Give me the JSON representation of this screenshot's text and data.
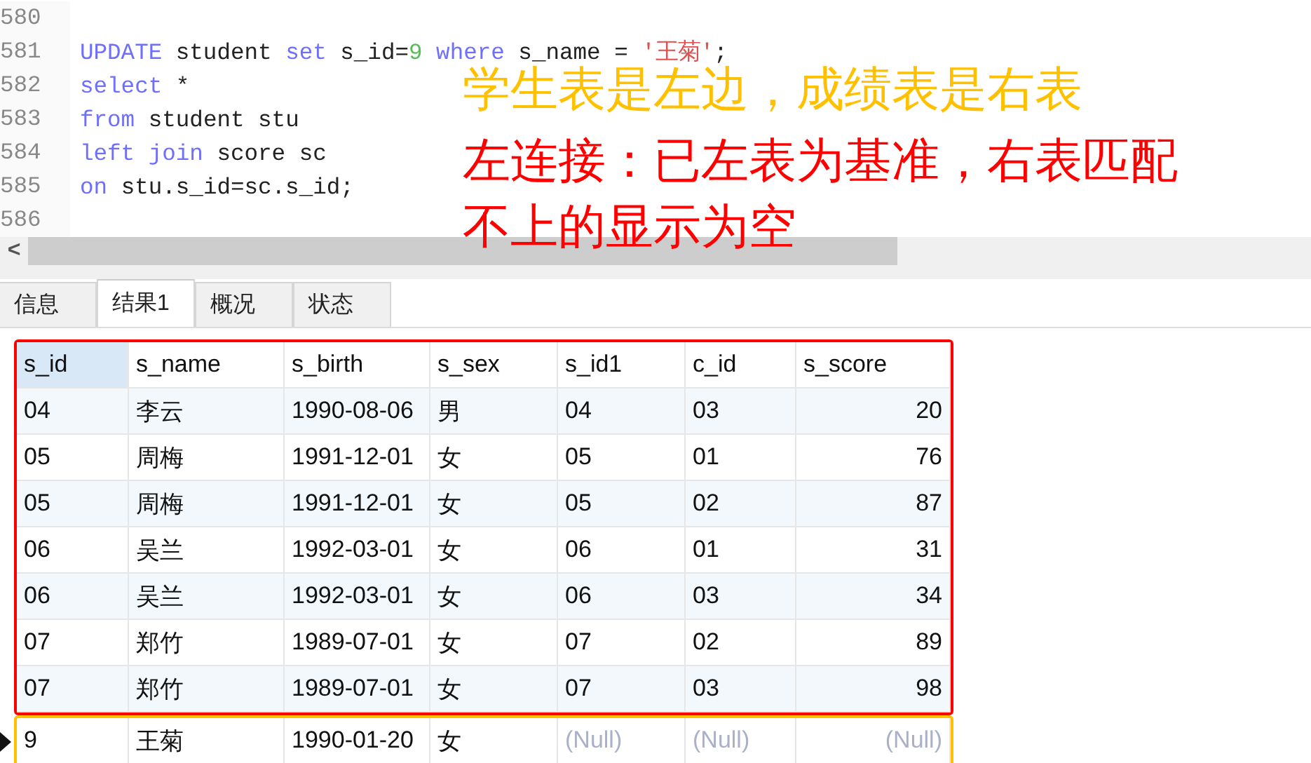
{
  "editor": {
    "lines": [
      {
        "number": "580"
      },
      {
        "number": "581",
        "tokens": [
          {
            "kind": "keyword",
            "text": "UPDATE"
          },
          {
            "kind": "plain",
            "text": " student "
          },
          {
            "kind": "keyword",
            "text": "set"
          },
          {
            "kind": "plain",
            "text": " s_id="
          },
          {
            "kind": "number",
            "text": "9"
          },
          {
            "kind": "keyword",
            "text": " where"
          },
          {
            "kind": "plain",
            "text": " s_name = "
          },
          {
            "kind": "string",
            "text": "'王菊'"
          },
          {
            "kind": "plain",
            "text": ";"
          }
        ]
      },
      {
        "number": "582",
        "tokens": [
          {
            "kind": "keyword",
            "text": "select"
          },
          {
            "kind": "plain",
            "text": " *"
          }
        ]
      },
      {
        "number": "583",
        "tokens": [
          {
            "kind": "keyword",
            "text": "from"
          },
          {
            "kind": "plain",
            "text": " student stu"
          }
        ]
      },
      {
        "number": "584",
        "tokens": [
          {
            "kind": "keyword",
            "text": "left join"
          },
          {
            "kind": "plain",
            "text": " score sc"
          }
        ]
      },
      {
        "number": "585",
        "tokens": [
          {
            "kind": "keyword",
            "text": "on"
          },
          {
            "kind": "plain",
            "text": " stu.s_id=sc.s_id;"
          }
        ]
      },
      {
        "number": "586"
      }
    ],
    "scroll_left": "<"
  },
  "annotations": [
    {
      "text": "学生表是左边，成绩表是右表",
      "color": "#ffc000"
    },
    {
      "text": "左连接：已左表为基准，右表匹配不上的显示为空",
      "color": "#ff0000"
    }
  ],
  "tabs": [
    {
      "label": "信息",
      "selected": false
    },
    {
      "label": "结果1",
      "selected": true
    },
    {
      "label": "概况",
      "selected": false
    },
    {
      "label": "状态",
      "selected": false
    }
  ],
  "table": {
    "columns": [
      {
        "name": "s_id",
        "selected": true
      },
      {
        "name": "s_name",
        "selected": false
      },
      {
        "name": "s_birth",
        "selected": false
      },
      {
        "name": "s_sex",
        "selected": false
      },
      {
        "name": "s_id1",
        "selected": false
      },
      {
        "name": "c_id",
        "selected": false
      },
      {
        "name": "s_score",
        "selected": false
      }
    ],
    "groups": [
      {
        "color": "#ff0000",
        "rows": [
          {
            "cells": [
              {
                "text": "04",
                "null": false
              },
              {
                "text": "李云",
                "null": false
              },
              {
                "text": "1990-08-06",
                "null": false
              },
              {
                "text": "男",
                "null": false
              },
              {
                "text": "04",
                "null": false
              },
              {
                "text": "03",
                "null": false
              },
              {
                "text": "20",
                "null": false
              }
            ],
            "current": false
          },
          {
            "cells": [
              {
                "text": "05",
                "null": false
              },
              {
                "text": "周梅",
                "null": false
              },
              {
                "text": "1991-12-01",
                "null": false
              },
              {
                "text": "女",
                "null": false
              },
              {
                "text": "05",
                "null": false
              },
              {
                "text": "01",
                "null": false
              },
              {
                "text": "76",
                "null": false
              }
            ],
            "current": false
          },
          {
            "cells": [
              {
                "text": "05",
                "null": false
              },
              {
                "text": "周梅",
                "null": false
              },
              {
                "text": "1991-12-01",
                "null": false
              },
              {
                "text": "女",
                "null": false
              },
              {
                "text": "05",
                "null": false
              },
              {
                "text": "02",
                "null": false
              },
              {
                "text": "87",
                "null": false
              }
            ],
            "current": false
          },
          {
            "cells": [
              {
                "text": "06",
                "null": false
              },
              {
                "text": "吴兰",
                "null": false
              },
              {
                "text": "1992-03-01",
                "null": false
              },
              {
                "text": "女",
                "null": false
              },
              {
                "text": "06",
                "null": false
              },
              {
                "text": "01",
                "null": false
              },
              {
                "text": "31",
                "null": false
              }
            ],
            "current": false
          },
          {
            "cells": [
              {
                "text": "06",
                "null": false
              },
              {
                "text": "吴兰",
                "null": false
              },
              {
                "text": "1992-03-01",
                "null": false
              },
              {
                "text": "女",
                "null": false
              },
              {
                "text": "06",
                "null": false
              },
              {
                "text": "03",
                "null": false
              },
              {
                "text": "34",
                "null": false
              }
            ],
            "current": false
          },
          {
            "cells": [
              {
                "text": "07",
                "null": false
              },
              {
                "text": "郑竹",
                "null": false
              },
              {
                "text": "1989-07-01",
                "null": false
              },
              {
                "text": "女",
                "null": false
              },
              {
                "text": "07",
                "null": false
              },
              {
                "text": "02",
                "null": false
              },
              {
                "text": "89",
                "null": false
              }
            ],
            "current": false
          },
          {
            "cells": [
              {
                "text": "07",
                "null": false
              },
              {
                "text": "郑竹",
                "null": false
              },
              {
                "text": "1989-07-01",
                "null": false
              },
              {
                "text": "女",
                "null": false
              },
              {
                "text": "07",
                "null": false
              },
              {
                "text": "03",
                "null": false
              },
              {
                "text": "98",
                "null": false
              }
            ],
            "current": false
          }
        ]
      },
      {
        "color": "#ffc000",
        "rows": [
          {
            "cells": [
              {
                "text": "9",
                "null": false
              },
              {
                "text": "王菊",
                "null": false
              },
              {
                "text": "1990-01-20",
                "null": false
              },
              {
                "text": "女",
                "null": false
              },
              {
                "text": "(Null)",
                "null": true
              },
              {
                "text": "(Null)",
                "null": true
              },
              {
                "text": "(Null)",
                "null": true
              }
            ],
            "current": true
          }
        ]
      }
    ]
  }
}
